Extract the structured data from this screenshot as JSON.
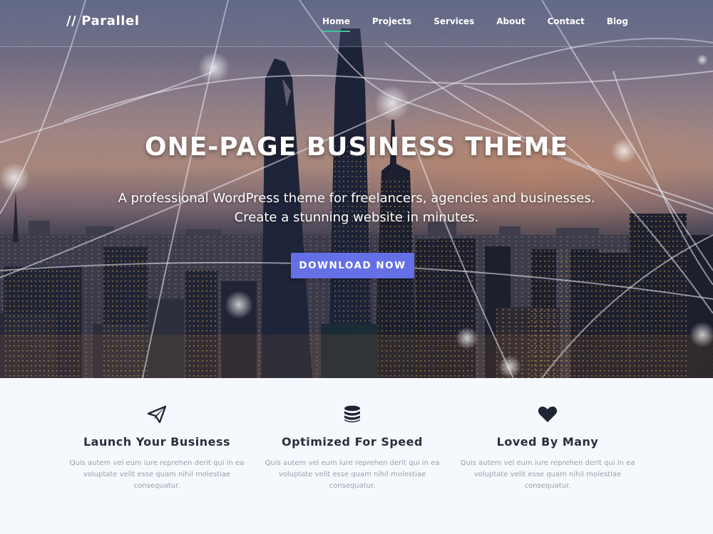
{
  "site": {
    "logo": "// Parallel"
  },
  "nav": {
    "items": [
      {
        "label": "Home",
        "active": true
      },
      {
        "label": "Projects",
        "active": false
      },
      {
        "label": "Services",
        "active": false
      },
      {
        "label": "About",
        "active": false
      },
      {
        "label": "Contact",
        "active": false
      },
      {
        "label": "Blog",
        "active": false
      }
    ]
  },
  "hero": {
    "title": "ONE-PAGE BUSINESS THEME",
    "subtitle_line1": "A professional WordPress theme for freelancers, agencies and businesses.",
    "subtitle_line2": "Create a stunning website in minutes.",
    "cta_label": "DOWNLOAD NOW",
    "background_image": "city-skyline-at-dusk"
  },
  "features": [
    {
      "icon": "paper-plane-icon",
      "title": "Launch Your Business",
      "desc_line1": "Quis autem vel eum iure reprehen derit qui in ea",
      "desc_line2": "voluptate velit esse quam nihil molestiae",
      "desc_line3": "consequatur."
    },
    {
      "icon": "database-icon",
      "title": "Optimized For Speed",
      "desc_line1": "Quis autem vel eum iure reprehen derit qui in ea",
      "desc_line2": "voluptate velit esse quam nihil molestiae",
      "desc_line3": "consequatur."
    },
    {
      "icon": "heart-icon",
      "title": "Loved By Many",
      "desc_line1": "Quis autem vel eum iure reprehen derit qui in ea",
      "desc_line2": "voluptate velit esse quam nihil molestiae",
      "desc_line3": "consequatur."
    }
  ],
  "colors": {
    "accent_button": "#6670e6",
    "nav_active_underline": "#3fc6a0",
    "feature_title": "#2a2f3a",
    "feature_text": "#9aa1ab",
    "features_background": "#f5f8fc"
  }
}
